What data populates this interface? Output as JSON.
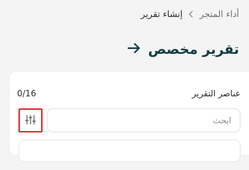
{
  "breadcrumb": {
    "parent_label": "أداء المتجر",
    "current_label": "إنشاء تقرير"
  },
  "header": {
    "title": "تقرير مخصص",
    "back_icon": "arrow-right-icon"
  },
  "report_elements": {
    "title": "عناصر التقرير",
    "counter": "0/16",
    "search": {
      "placeholder": "ابحث",
      "value": ""
    },
    "filter_icon": "sliders-icon"
  },
  "colors": {
    "background": "#f4f4f4",
    "card": "#ffffff",
    "title": "#123c42",
    "highlight": "#e0262a"
  }
}
